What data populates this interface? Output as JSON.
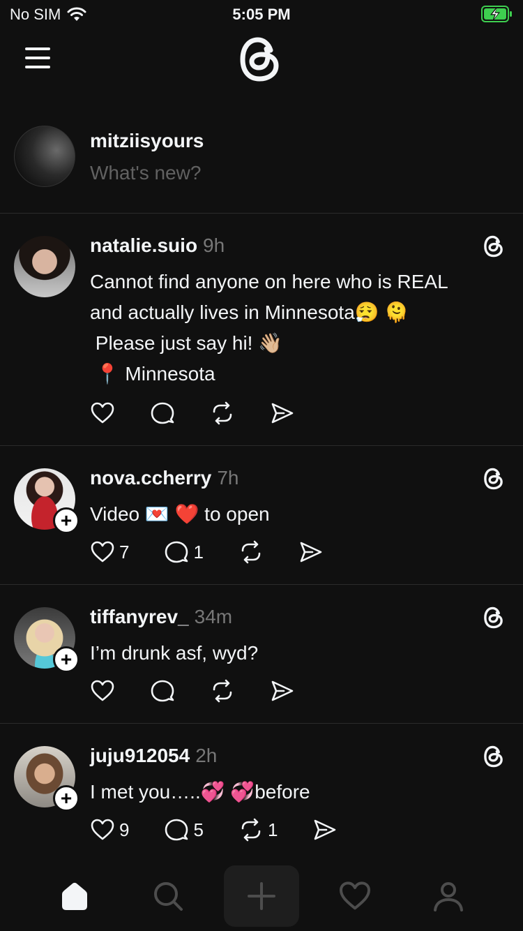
{
  "status_bar": {
    "carrier": "No SIM",
    "time": "5:05 PM"
  },
  "composer": {
    "username": "mitziisyours",
    "placeholder": "What's new?"
  },
  "posts": [
    {
      "username": "natalie.suio",
      "time": "9h",
      "lines": [
        "Cannot find anyone on here who is REAL",
        "and actually lives in Minnesota😮‍💨 🫠",
        " Please just say hi! 👋🏼",
        " 📍 Minnesota"
      ],
      "likes": "",
      "replies": "",
      "reposts": ""
    },
    {
      "username": "nova.ccherry",
      "time": "7h",
      "lines": [
        "Video 💌 ❤️ to open"
      ],
      "likes": "7",
      "replies": "1",
      "reposts": ""
    },
    {
      "username": "tiffanyrev_",
      "time": "34m",
      "lines": [
        "I’m drunk asf, wyd?"
      ],
      "likes": "",
      "replies": "",
      "reposts": ""
    },
    {
      "username": "juju912054",
      "time": "2h",
      "lines": [
        "I met you…..💞 💞before"
      ],
      "likes": "9",
      "replies": "5",
      "reposts": "1"
    }
  ],
  "tab_bar": {
    "tabs": [
      "home-icon",
      "search-icon",
      "create-icon",
      "activity-icon",
      "profile-icon"
    ]
  }
}
